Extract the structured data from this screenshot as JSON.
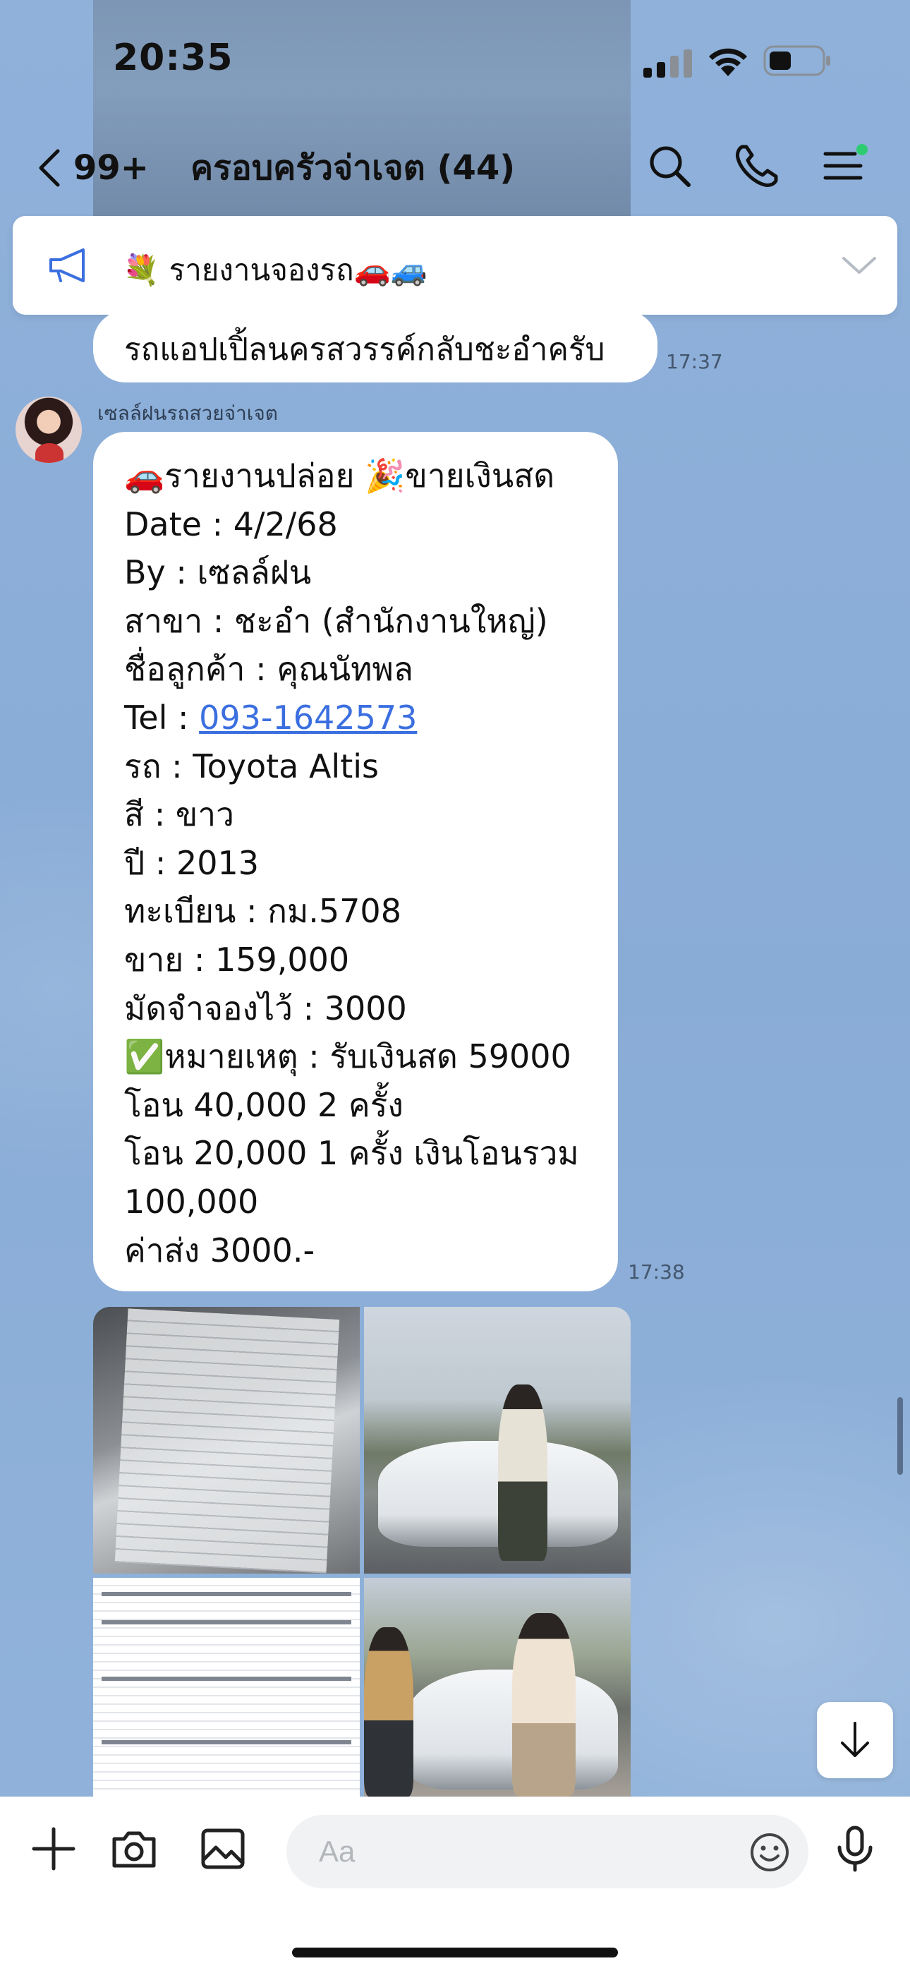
{
  "status_bar": {
    "time": "20:35"
  },
  "header": {
    "back_count": "99+",
    "title": "ครอบครัวจ่าเจต (44)",
    "icons": [
      "search-icon",
      "phone-icon",
      "menu-icon"
    ]
  },
  "announcement": {
    "text": "💐 รายงานจองรถ🚗🚙",
    "icon": "megaphone-icon"
  },
  "messages": [
    {
      "text": "รถแอปเปิ้ลนครสวรรค์กลับชะอำครับ",
      "time": "17:37"
    },
    {
      "sender": "เซลล์ฝนรถสวยจ่าเจต",
      "time": "17:38",
      "lines": {
        "l1": "🚗รายงานปล่อย 🎉ขายเงินสด",
        "l2": "Date : 4/2/68",
        "l3": "By : เซลล์ฝน",
        "l4": "สาขา : ชะอำ (สำนักงานใหญ่)",
        "l5": "ชื่อลูกค้า : คุณนัทพล",
        "l6_label": "Tel : ",
        "l6_phone": "093-1642573",
        "l7": "รถ : Toyota Altis",
        "l8": "สี : ขาว",
        "l9": "ปี : 2013",
        "l10": "ทะเบียน : กม.5708",
        "l11": "ขาย : 159,000",
        "l12": "มัดจำจองไว้ : 3000",
        "l13": "✅หมายเหตุ : รับเงินสด 59000",
        "l14": "โอน 40,000 2 ครั้ง",
        "l15": "โอน 20,000 1 ครั้ง เงินโอนรวม",
        "l16": "100,000",
        "l17": "ค่าส่ง 3000.-"
      }
    }
  ],
  "photos": [
    "contract-document-photo",
    "customer-with-car-photo",
    "sales-form-photo",
    "handover-photo"
  ],
  "composer": {
    "placeholder": "Aa",
    "icons": [
      "plus-icon",
      "camera-icon",
      "image-icon",
      "emoji-icon",
      "microphone-icon"
    ]
  },
  "colors": {
    "background": "#8aaed8",
    "bubble": "#ffffff",
    "link": "#3b6fe0",
    "online_dot": "#2ecc71"
  }
}
